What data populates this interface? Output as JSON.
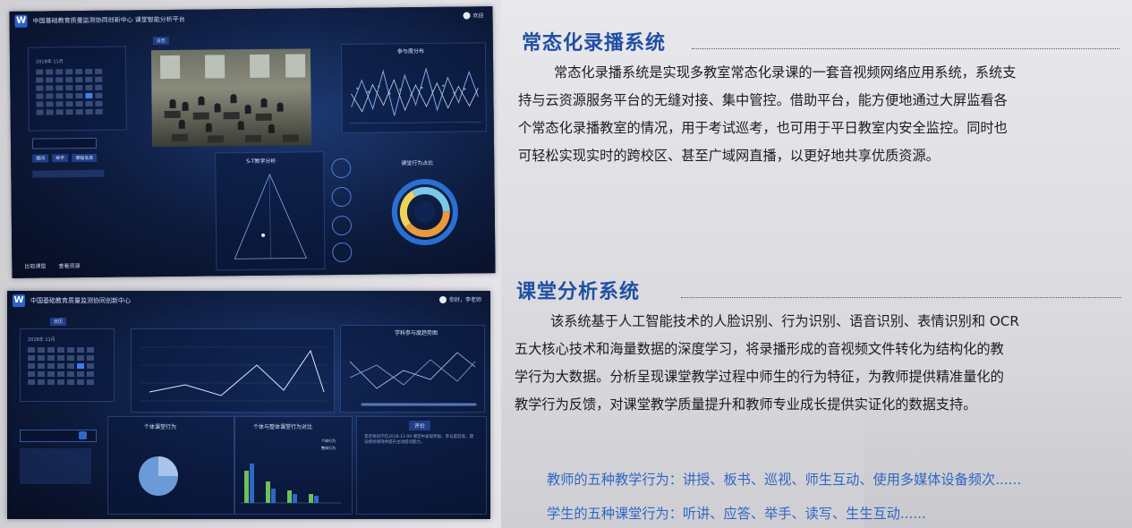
{
  "screen1": {
    "title": "中国基础教育质量监测协同创新中心 课堂智能分析平台",
    "user": "欢迎",
    "tab": "日历",
    "date_label": "2018年 11月",
    "video_caption": "",
    "chart1_title": "参与度分布",
    "chart2_title": "S-T教学分析",
    "chart3_title": "课堂行为占比",
    "left_btns": [
      "提问",
      "举手",
      "课程信息"
    ],
    "bottom_btns": [
      "比较课型",
      "查看资源"
    ]
  },
  "screen2": {
    "title": "中国基础教育质量监测协同创新中心",
    "user": "你好，李老师",
    "tab": "日历",
    "date_label": "2018年 11月",
    "chart1_title": "学科参与度趋势图",
    "chart2_title": "个体课堂行为",
    "chart3_title": "个体与整体课堂行为对比",
    "eval_title": "评价",
    "eval_text": "李老师同学在2018-11-09 课堂中表现积极，参与度较高，建议继续保持并提升主动提问能力。",
    "legend_a": "个体行为",
    "legend_b": "整体行为"
  },
  "section1": {
    "heading": "常态化录播系统",
    "lines": [
      "常态化录播系统是实现多教室常态化录课的一套音视频网络应用系统，系统支",
      "持与云资源服务平台的无缝对接、集中管控。借助平台，能方便地通过大屏监看各",
      "个常态化录播教室的情况，用于考试巡考，也可用于平日教室内安全监控。同时也",
      "可轻松实现实时的跨校区、甚至广域网直播，以更好地共享优质资源。"
    ]
  },
  "section2": {
    "heading": "课堂分析系统",
    "lines": [
      "该系统基于人工智能技术的人脸识别、行为识别、语音识别、表情识别和 OCR",
      "五大核心技术和海量数据的深度学习，将录播形成的音视频文件转化为结构化的教",
      "学行为大数据。分析呈现课堂教学过程中师生的行为特征，为教师提供精准量化的",
      "教学行为反馈，对课堂教学质量提升和教师专业成长提供实证化的数据支持。"
    ],
    "teacher_behaviors": "教师的五种教学行为：讲授、板书、巡视、师生互动、使用多媒体设备频次......",
    "student_behaviors": "学生的五种课堂行为：听讲、应答、举手、读写、生生互动......"
  },
  "colors": {
    "heading": "#1f4fa3",
    "highlight": "#2f67c4",
    "body": "#1b1b20"
  }
}
